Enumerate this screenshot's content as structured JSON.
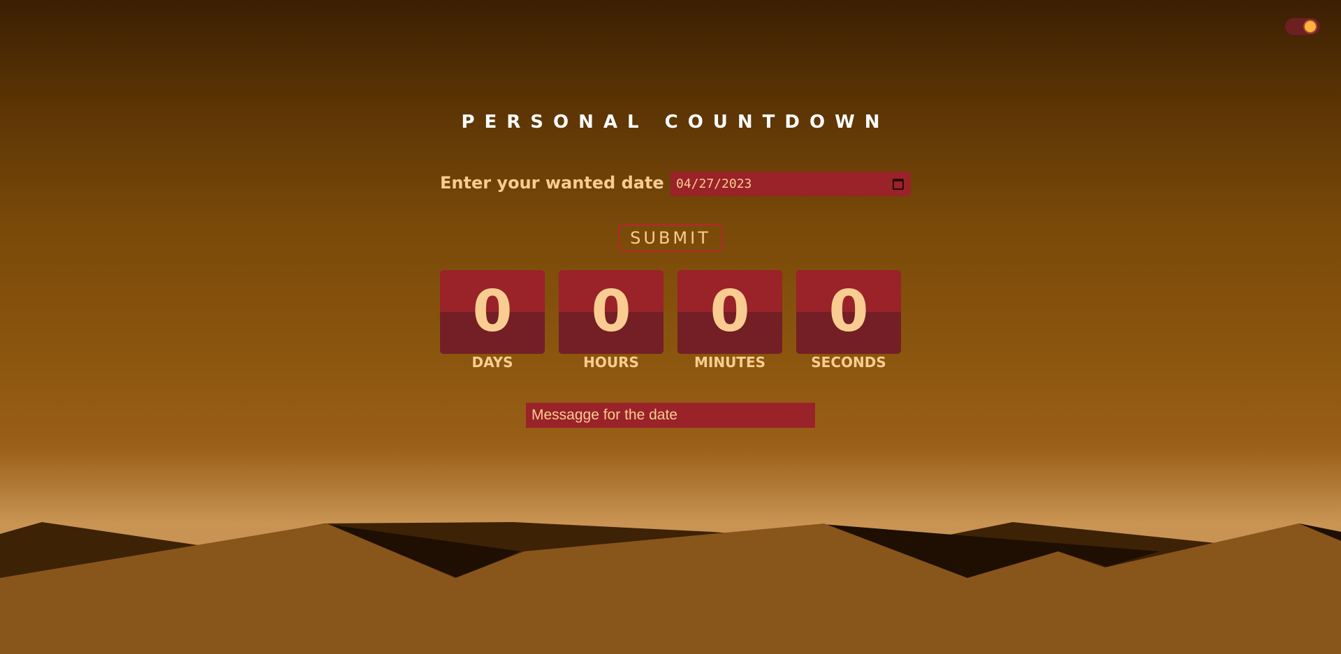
{
  "theme_toggle": {
    "icon": "sun-icon",
    "state": "light"
  },
  "title": "PERSONAL COUNTDOWN",
  "date_form": {
    "label": "Enter your wanted date",
    "value": "04/27/2023"
  },
  "submit_label": "SUBMIT",
  "countdown": [
    {
      "value": "0",
      "unit": "DAYS"
    },
    {
      "value": "0",
      "unit": "HOURS"
    },
    {
      "value": "0",
      "unit": "MINUTES"
    },
    {
      "value": "0",
      "unit": "SECONDS"
    }
  ],
  "message": {
    "placeholder": "Messagge for the date"
  },
  "colors": {
    "accent": "#9a2229",
    "text": "#f9cd91",
    "card_dark": "#741f25"
  }
}
